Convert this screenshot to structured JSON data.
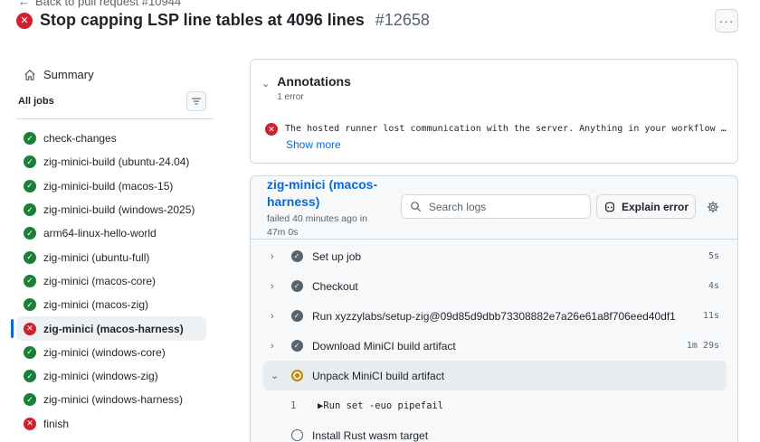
{
  "header": {
    "back_label": "Back to pull request #10944",
    "title": "Stop capping LSP line tables at 4096 lines",
    "number": "#12658",
    "more_symbol": "···"
  },
  "sidebar": {
    "summary_label": "Summary",
    "all_jobs_label": "All jobs",
    "jobs": [
      {
        "label": "check-changes",
        "status": "success"
      },
      {
        "label": "zig-minici-build (ubuntu-24.04)",
        "status": "success"
      },
      {
        "label": "zig-minici-build (macos-15)",
        "status": "success"
      },
      {
        "label": "zig-minici-build (windows-2025)",
        "status": "success"
      },
      {
        "label": "arm64-linux-hello-world",
        "status": "success"
      },
      {
        "label": "zig-minici (ubuntu-full)",
        "status": "success"
      },
      {
        "label": "zig-minici (macos-core)",
        "status": "success"
      },
      {
        "label": "zig-minici (macos-zig)",
        "status": "success"
      },
      {
        "label": "zig-minici (macos-harness)",
        "status": "failure",
        "active": true
      },
      {
        "label": "zig-minici (windows-core)",
        "status": "success"
      },
      {
        "label": "zig-minici (windows-zig)",
        "status": "success"
      },
      {
        "label": "zig-minici (windows-harness)",
        "status": "success"
      },
      {
        "label": "finish",
        "status": "failure"
      }
    ]
  },
  "annotations": {
    "title": "Annotations",
    "count": "1 error",
    "message": "The hosted runner lost communication with the server. Anything in your workflow t…",
    "show_more": "Show more"
  },
  "log": {
    "job_name_line1": "zig-minici (macos-",
    "job_name_line2": "harness)",
    "meta_line1": "failed 40 minutes ago in",
    "meta_line2": "47m 0s",
    "search_placeholder": "Search logs",
    "explain_label": "Explain error",
    "steps": [
      {
        "name": "Set up job",
        "duration": "5s",
        "state": "done"
      },
      {
        "name": "Checkout",
        "duration": "4s",
        "state": "done"
      },
      {
        "name": "Run xyzzylabs/setup-zig@09d85d9dbb73308882e7a26e61a8f706eed40df1",
        "duration": "11s",
        "state": "done"
      },
      {
        "name": "Download MiniCI build artifact",
        "duration": "1m 29s",
        "state": "done"
      },
      {
        "name": "Unpack MiniCI build artifact",
        "duration": "",
        "state": "running"
      },
      {
        "name": "Install Rust wasm target",
        "duration": "",
        "state": "pending"
      }
    ],
    "log_line": {
      "number": "1",
      "text": "▶Run set -euo pipefail"
    }
  },
  "colors": {
    "success": "#1a7f37",
    "failure": "#cf222e",
    "link": "#0969da",
    "running": "#bf8700"
  }
}
